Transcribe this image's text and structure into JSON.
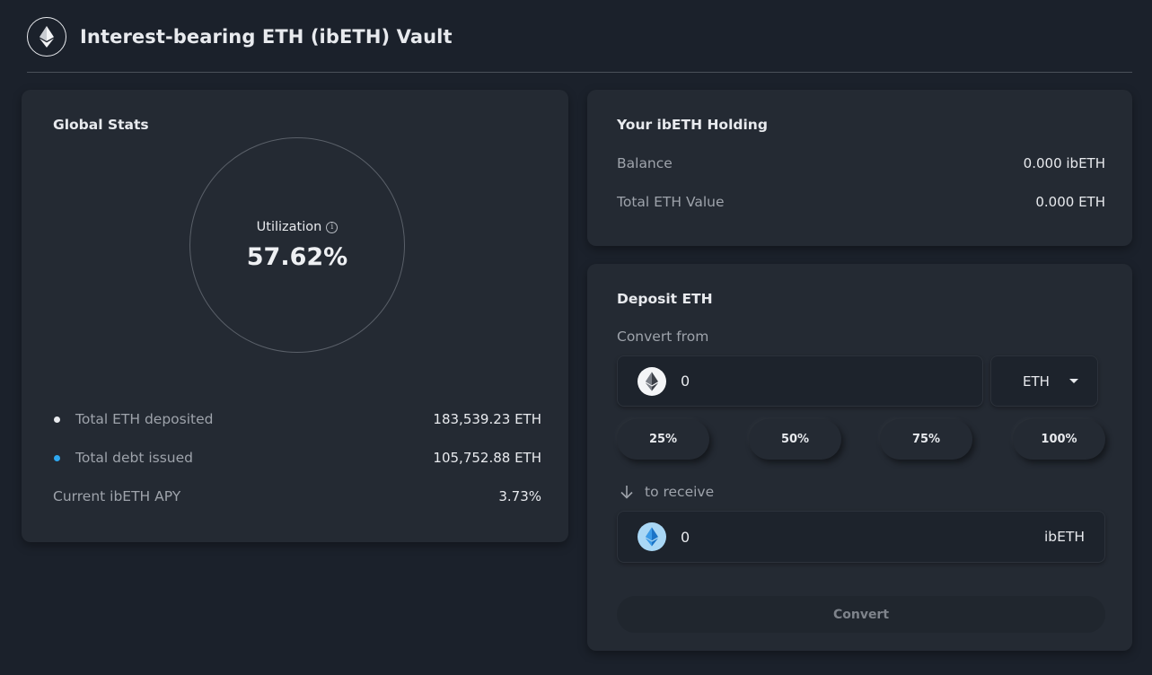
{
  "header": {
    "title": "Interest-bearing ETH (ibETH) Vault",
    "logo_icon": "ethereum-icon"
  },
  "global_stats": {
    "title": "Global Stats",
    "utilization_label": "Utilization",
    "utilization_value": "57.62%",
    "rows": [
      {
        "label": "Total ETH deposited",
        "value": "183,539.23 ETH",
        "dot_color": "#e8eaee"
      },
      {
        "label": "Total debt issued",
        "value": "105,752.88 ETH",
        "dot_color": "#2ea8f0"
      },
      {
        "label": "Current ibETH APY",
        "value": "3.73%"
      }
    ]
  },
  "holding": {
    "title": "Your ibETH Holding",
    "rows": [
      {
        "label": "Balance",
        "value": "0.000 ibETH"
      },
      {
        "label": "Total ETH Value",
        "value": "0.000 ETH"
      }
    ]
  },
  "deposit": {
    "title": "Deposit ETH",
    "convert_from_label": "Convert from",
    "from_value": "0",
    "from_token": "ETH",
    "percent_buttons": [
      "25%",
      "50%",
      "75%",
      "100%"
    ],
    "to_receive_label": "to receive",
    "to_value": "0",
    "to_token": "ibETH",
    "convert_button": "Convert"
  },
  "colors": {
    "background": "#1b212b",
    "card": "#242a33",
    "accent_blue": "#2ea8f0"
  }
}
